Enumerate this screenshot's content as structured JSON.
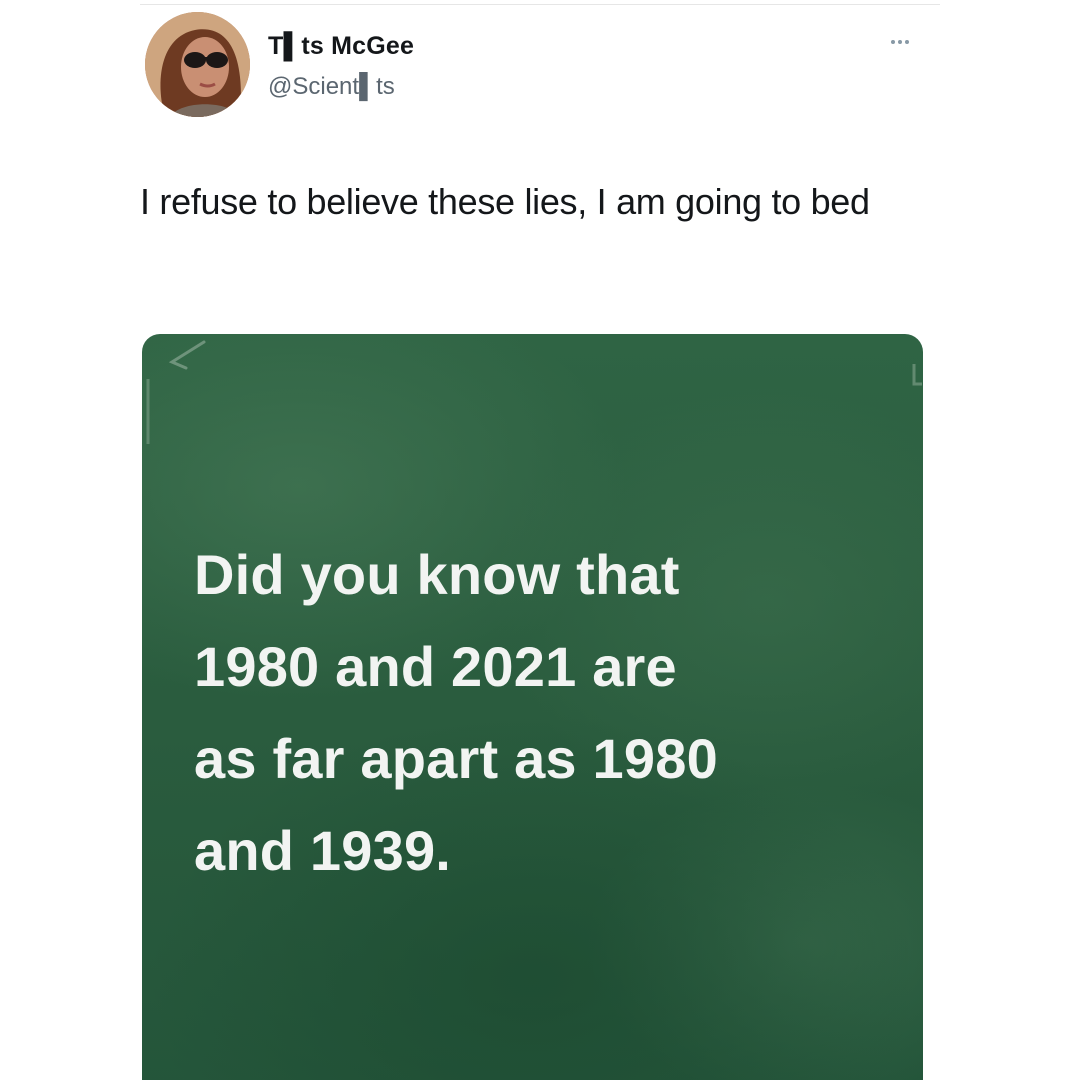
{
  "tweet": {
    "author": {
      "display_name": "T▌ts McGee",
      "handle": "@Scient▌ts",
      "avatar_icon": "profile-photo"
    },
    "more_icon": "more-horizontal-icon",
    "text": "I refuse to believe these lies, I am going to bed",
    "media": {
      "background_color": "#2c5f3f",
      "text_color": "#f2f4f2",
      "lines": [
        "Did you know that",
        "1980 and 2021 are",
        "as far apart as 1980",
        "and 1939."
      ]
    }
  }
}
